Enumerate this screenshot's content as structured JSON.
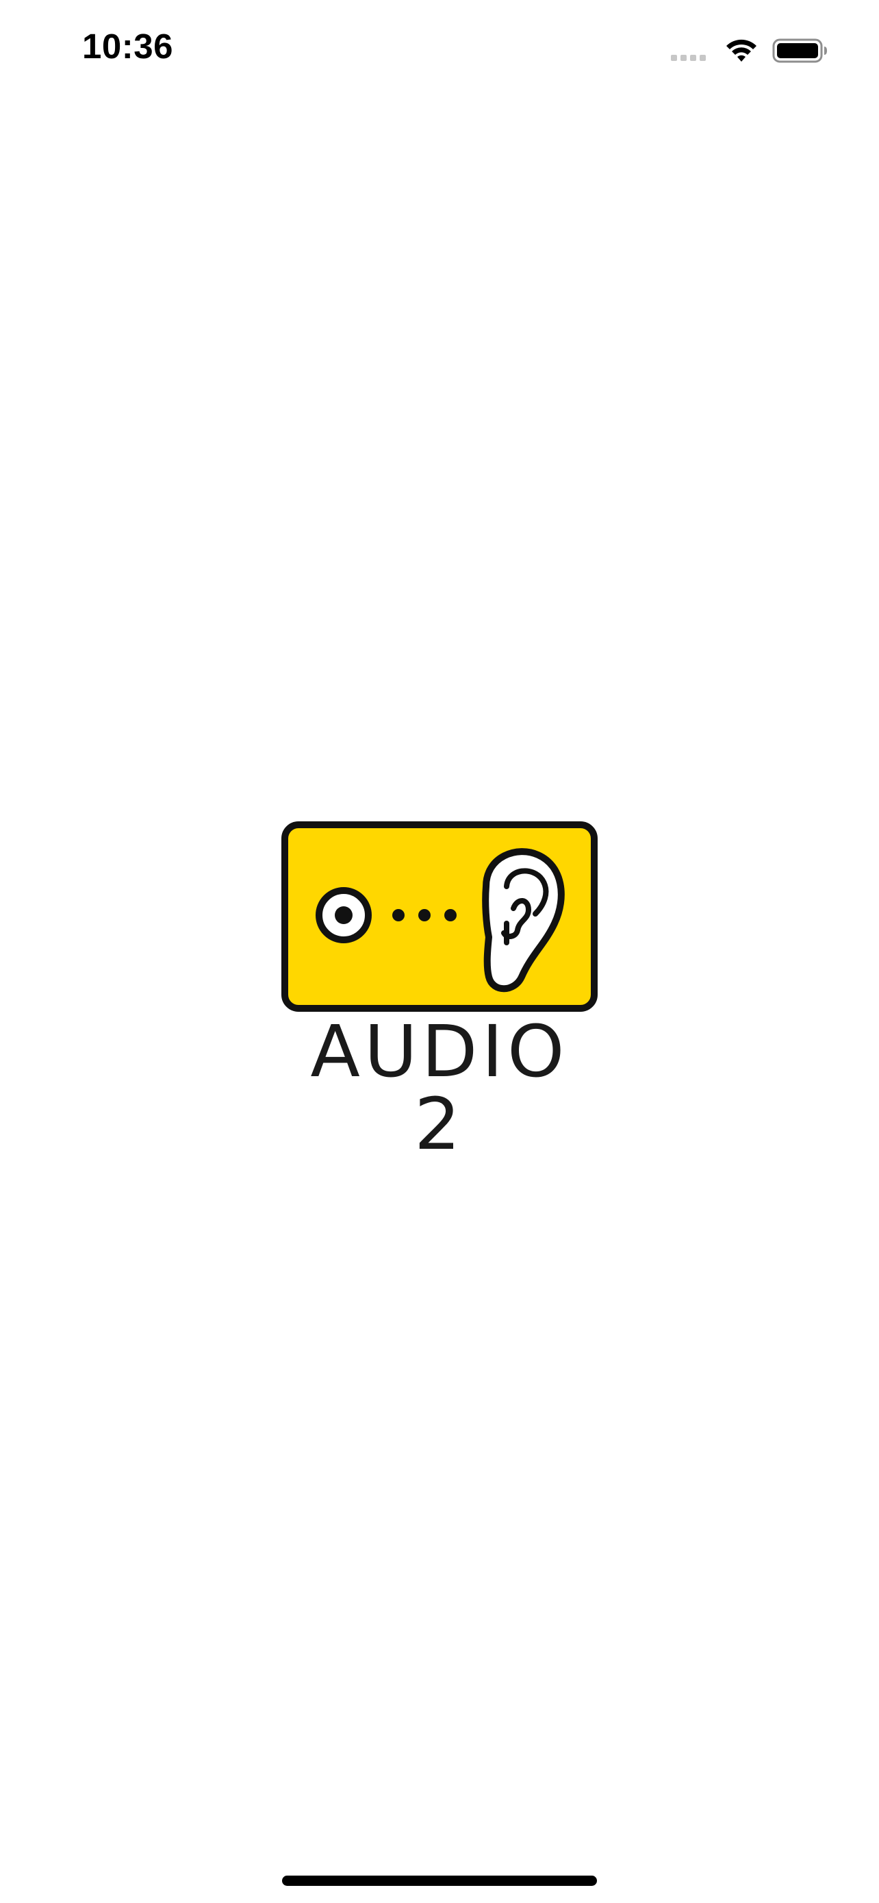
{
  "status_bar": {
    "time": "10:36",
    "icons": [
      "signal-icon",
      "wifi-icon",
      "battery-icon"
    ]
  },
  "splash": {
    "logo_text": "AUDIO 2",
    "logo_icons": [
      "speaker-dot-icon",
      "ear-icon"
    ],
    "colors": {
      "brand_yellow": "#FFD700",
      "logo_outline": "#111111",
      "background": "#FFFFFF"
    }
  }
}
